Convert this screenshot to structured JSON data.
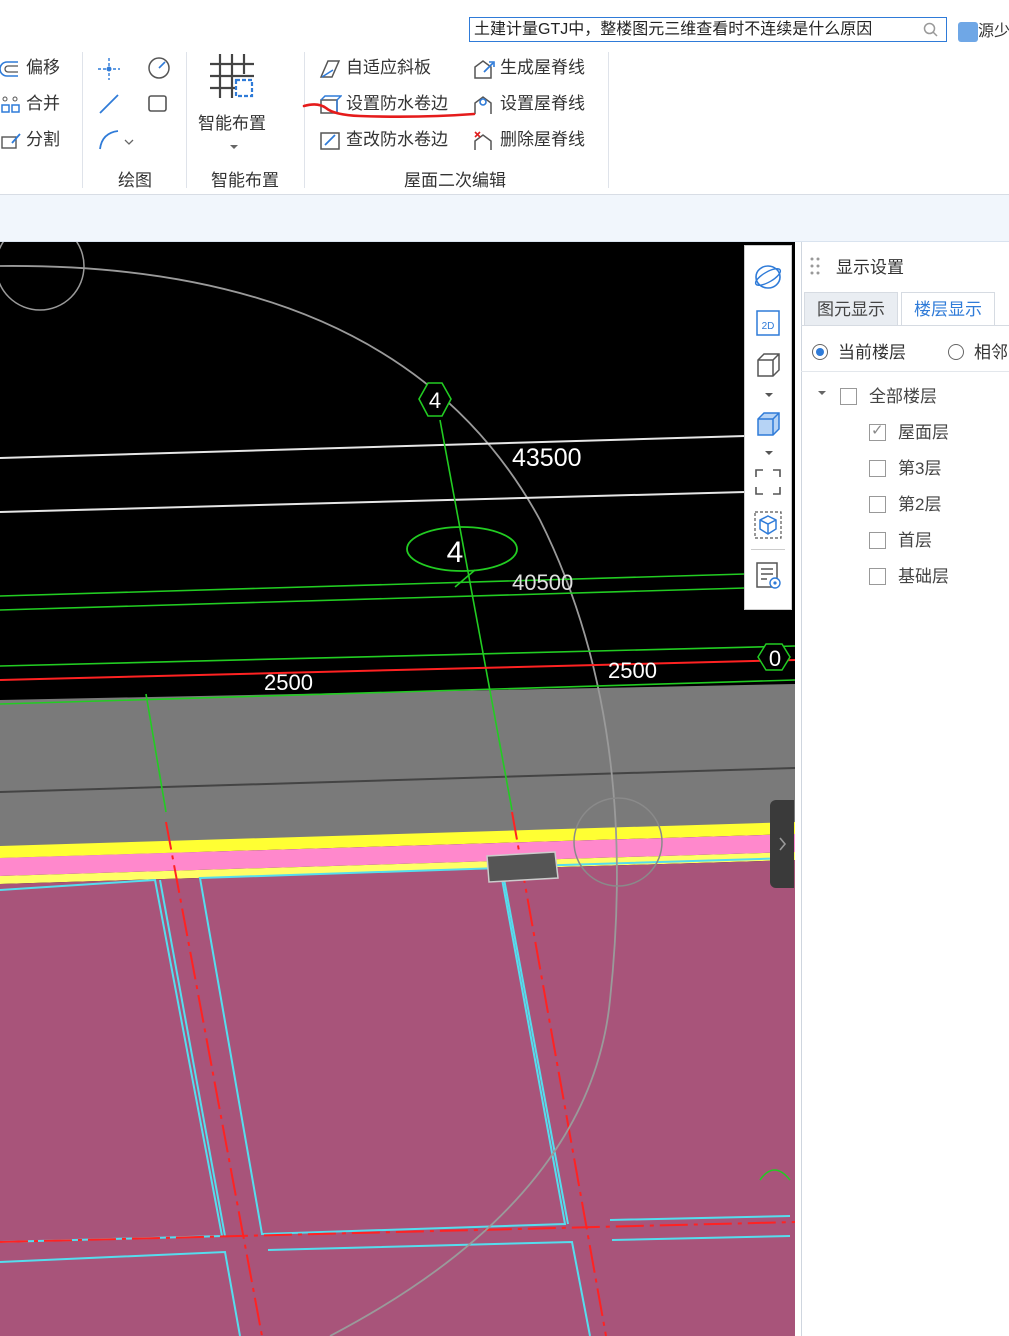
{
  "search": {
    "value": "土建计量GTJ中，整楼图元三维查看时不连续是什么原因"
  },
  "user": {
    "name": "源少"
  },
  "ribbon": {
    "edit_items": [
      {
        "label": "偏移",
        "icon": "offset-icon"
      },
      {
        "label": "合并",
        "icon": "merge-icon"
      },
      {
        "label": "分割",
        "icon": "split-icon"
      }
    ],
    "draw_group_label": "绘图",
    "smart_button_label": "智能布置",
    "smart_group_label": "智能布置",
    "roof_items": [
      {
        "label": "自适应斜板",
        "icon": "adaptive-slab-icon"
      },
      {
        "label": "设置防水卷边",
        "icon": "waterproof-edge-icon"
      },
      {
        "label": "查改防水卷边",
        "icon": "edit-waterproof-edge-icon"
      },
      {
        "label": "生成屋脊线",
        "icon": "generate-ridge-icon"
      },
      {
        "label": "设置屋脊线",
        "icon": "set-ridge-icon"
      },
      {
        "label": "删除屋脊线",
        "icon": "delete-ridge-icon"
      }
    ],
    "roof_group_label": "屋面二次编辑"
  },
  "viewport": {
    "axis_labels": {
      "top": "4",
      "ellipse": "4",
      "right": "0"
    },
    "dimensions": {
      "elev_top": "43500",
      "elev_mid": "40500",
      "span_left": "2500",
      "span_right": "2500"
    },
    "colors": {
      "background": "#000000",
      "roof": "#a8547a",
      "parapet_top": "#ffff33",
      "parapet_band": "#ff88cc",
      "axis": "#ff2222",
      "grid": "#22cc22",
      "outline": "#55ddee"
    }
  },
  "panel": {
    "title": "显示设置",
    "tabs": [
      "图元显示",
      "楼层显示"
    ],
    "active_tab": "楼层显示",
    "radios": [
      "当前楼层",
      "相邻"
    ],
    "tree_root": "全部楼层",
    "floors": [
      {
        "label": "屋面层",
        "checked": true
      },
      {
        "label": "第3层",
        "checked": false
      },
      {
        "label": "第2层",
        "checked": false
      },
      {
        "label": "首层",
        "checked": false
      },
      {
        "label": "基础层",
        "checked": false
      }
    ]
  }
}
